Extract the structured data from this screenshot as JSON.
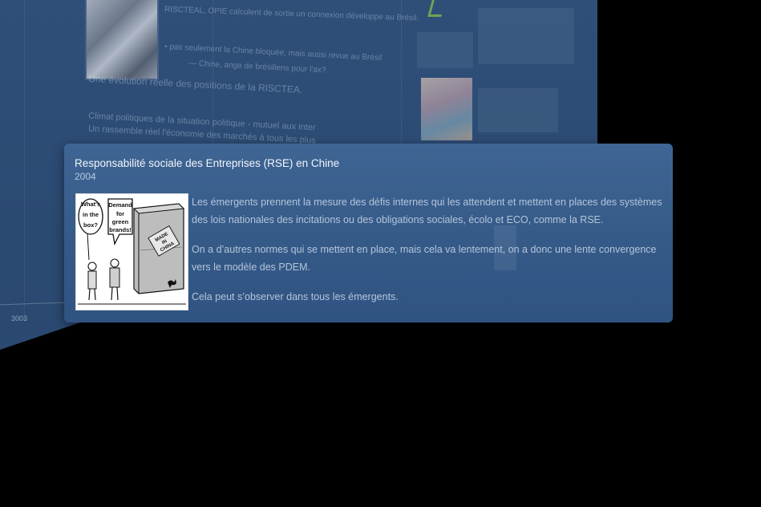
{
  "background": {
    "year_label": "3003",
    "ghost_lines": [
      "RISCTEAL, OPIE calculent de sortie un connexion développe au Brésil.",
      "• pas seulement la Chine bloquée, mais aussi revue au Brésil",
      "— Chine, ange de brésiliens pour l'ax?",
      "Une évolution réelle des positions de la RISCTEA.",
      "Climat politiques de la situation politique - mutuel aux inter",
      "Un rassemble réel l'économie des marchés à tous les plus"
    ]
  },
  "popup": {
    "title": "Responsabilité sociale des Entreprises (RSE) en Chine",
    "date": "2004",
    "paragraphs": [
      "Les émergents prennent la mesure des défis internes qui les attendent et mettent en places des systèmes des lois nationales des incitations ou des obligations sociales, écolo et ECO, comme la RSE.",
      "On a d’autres normes qui se mettent en place, mais cela va lentement, on a donc une lente convergence vers le modèle des PDEM.",
      "Cela peut s’observer dans tous les émergents."
    ],
    "cartoon": {
      "bubble_left": "What's in the box?",
      "bubble_right": "Demand for green brands!",
      "crate_label": "MADE IN CHINA"
    }
  },
  "colors": {
    "popup_top": "#3f6594",
    "popup_bottom": "#305382",
    "background_panel": "#2f4f79",
    "body_text": "#b4c5da"
  }
}
